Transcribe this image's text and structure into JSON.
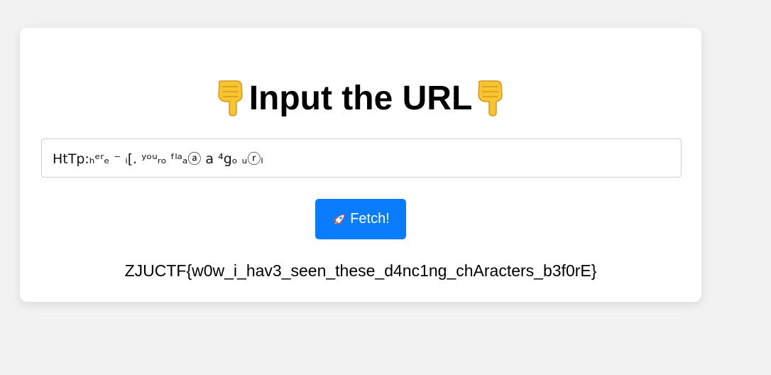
{
  "page": {
    "title": "Input the URL",
    "title_icon": "backhand-index-pointing-down-icon"
  },
  "url_input": {
    "value": "HtTp:ₕᵉʳₑ ⁻ ᵢ[. ʸᵒᵘᵣₒ ᶠˡᵃₐⓐ a ⁴gₒ ᵤⓡₗ"
  },
  "fetch_button": {
    "label": "Fetch!",
    "icon": "rocket-icon",
    "color": "#0a7cff"
  },
  "result": {
    "text": "ZJUCTF{w0w_i_hav3_seen_these_d4nc1ng_chAracters_b3f0rE}"
  }
}
